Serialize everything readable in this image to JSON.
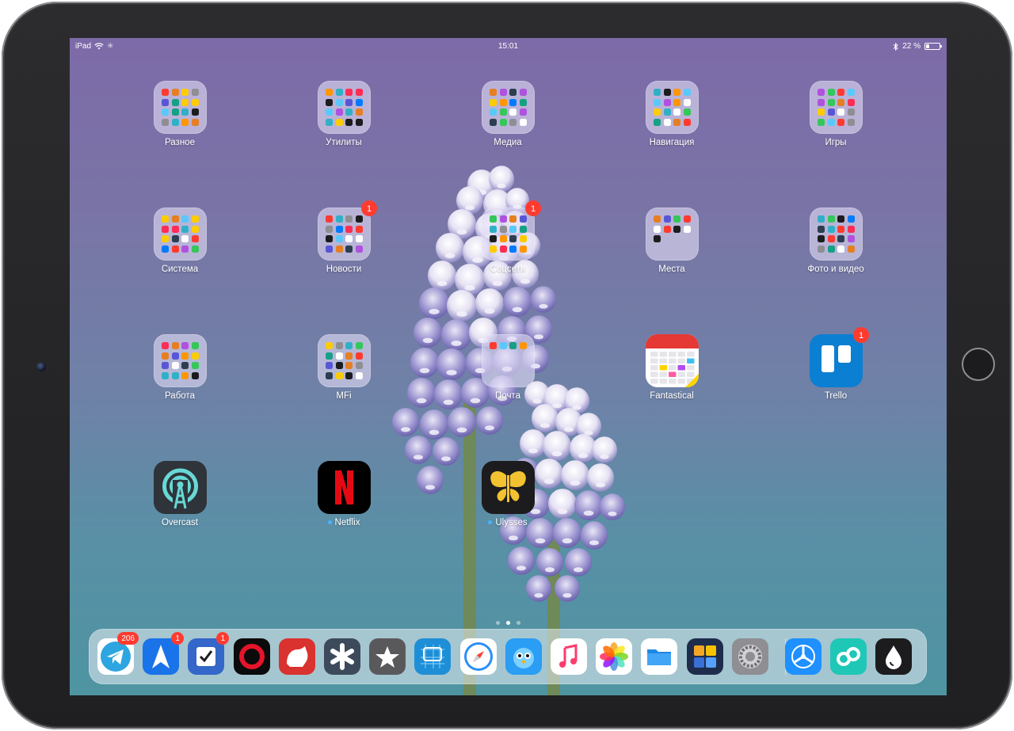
{
  "status_bar": {
    "device": "iPad",
    "time": "15:01",
    "battery_percent": "22 %",
    "battery_level": 0.22
  },
  "colors": {
    "badge": "#ff3b30",
    "accent_dot": "#46b3ff"
  },
  "home": {
    "items": [
      {
        "name": "folder-raznoe",
        "label": "Разное",
        "type": "folder"
      },
      {
        "name": "folder-utility",
        "label": "Утилиты",
        "type": "folder"
      },
      {
        "name": "folder-media",
        "label": "Медиа",
        "type": "folder"
      },
      {
        "name": "folder-navigation",
        "label": "Навигация",
        "type": "folder"
      },
      {
        "name": "folder-games",
        "label": "Игры",
        "type": "folder"
      },
      {
        "name": "folder-system",
        "label": "Система",
        "type": "folder"
      },
      {
        "name": "folder-news",
        "label": "Новости",
        "type": "folder",
        "badge": "1"
      },
      {
        "name": "folder-social",
        "label": "Соцсети",
        "type": "folder",
        "badge": "1"
      },
      {
        "name": "folder-places",
        "label": "Места",
        "type": "folder"
      },
      {
        "name": "folder-photo-video",
        "label": "Фото и видео",
        "type": "folder"
      },
      {
        "name": "folder-work",
        "label": "Работа",
        "type": "folder"
      },
      {
        "name": "folder-mfi",
        "label": "MFi",
        "type": "folder"
      },
      {
        "name": "folder-mail",
        "label": "Почта",
        "type": "folder"
      },
      {
        "name": "app-fantastical",
        "label": "Fantastical",
        "type": "app",
        "icon": "calendar-icon"
      },
      {
        "name": "app-trello",
        "label": "Trello",
        "type": "app",
        "icon": "trello-icon",
        "badge": "1"
      },
      {
        "name": "app-overcast",
        "label": "Overcast",
        "type": "app",
        "icon": "podcast-antenna-icon"
      },
      {
        "name": "app-netflix",
        "label": "Netflix",
        "type": "app",
        "icon": "netflix-n-icon",
        "new_dot": true
      },
      {
        "name": "app-ulysses",
        "label": "Ulysses",
        "type": "app",
        "icon": "butterfly-icon",
        "new_dot": true
      }
    ]
  },
  "page_indicator": {
    "pages": 3,
    "current": 2
  },
  "dock": {
    "apps": [
      {
        "name": "dock-telegram",
        "icon": "paper-plane-icon",
        "badge": "206"
      },
      {
        "name": "dock-spark",
        "icon": "send-arrow-icon",
        "badge": "1"
      },
      {
        "name": "dock-omnifocus-tasks",
        "icon": "checkbox-icon",
        "badge": "1"
      },
      {
        "name": "dock-activity",
        "icon": "ring-icon"
      },
      {
        "name": "dock-bear",
        "icon": "bear-icon"
      },
      {
        "name": "dock-launcher",
        "icon": "asterisk-icon"
      },
      {
        "name": "dock-reeder",
        "icon": "star-icon"
      },
      {
        "name": "dock-blueprint",
        "icon": "blueprint-icon"
      },
      {
        "name": "dock-safari",
        "icon": "compass-icon"
      },
      {
        "name": "dock-tweetbot",
        "icon": "bird-icon"
      },
      {
        "name": "dock-music",
        "icon": "music-note-icon"
      },
      {
        "name": "dock-photos",
        "icon": "photos-flower-icon"
      },
      {
        "name": "dock-files",
        "icon": "folder-icon"
      },
      {
        "name": "dock-documents",
        "icon": "documents-grid-icon"
      },
      {
        "name": "dock-settings",
        "icon": "gear-icon"
      },
      {
        "name": "dock-testflight",
        "icon": "propeller-icon"
      },
      {
        "name": "dock-workflow",
        "icon": "loop-icon"
      },
      {
        "name": "dock-drop",
        "icon": "water-drop-icon"
      }
    ]
  }
}
